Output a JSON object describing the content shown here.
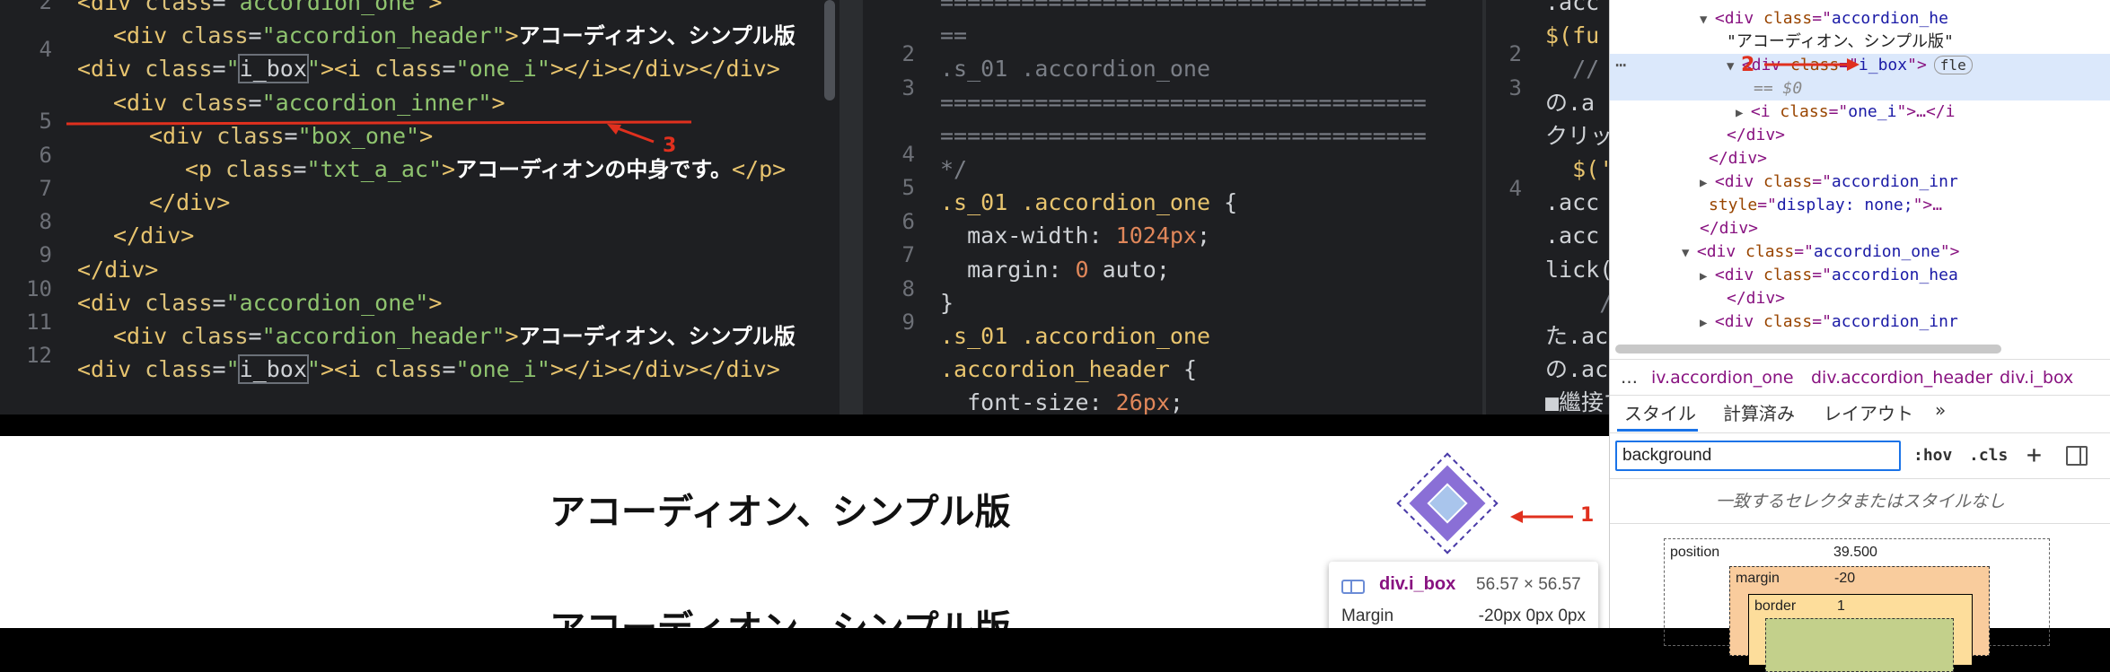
{
  "editor_left": {
    "line_numbers": [
      "2",
      "4",
      "5",
      "6",
      "7",
      "8",
      "9",
      "10",
      "11",
      "12"
    ],
    "lines": [
      {
        "parts": [
          [
            "tg",
            "<div "
          ],
          [
            "at",
            "class"
          ],
          [
            "pl",
            "="
          ],
          [
            "st",
            "\"accordion_one\""
          ],
          [
            "tg",
            ">"
          ]
        ]
      },
      {
        "parts": [
          [
            "tg",
            "<div "
          ],
          [
            "at",
            "class"
          ],
          [
            "pl",
            "="
          ],
          [
            "st",
            "\"accordion_header\""
          ],
          [
            "tg",
            ">"
          ],
          [
            "jp",
            "アコーディオン、シンプル版"
          ]
        ]
      },
      {
        "parts": [
          [
            "tg",
            "<div "
          ],
          [
            "at",
            "class"
          ],
          [
            "pl",
            "="
          ],
          [
            "st",
            "\""
          ],
          [
            "hl",
            "i_box"
          ],
          [
            "st",
            "\""
          ],
          [
            "tg",
            "><i "
          ],
          [
            "at",
            "class"
          ],
          [
            "pl",
            "="
          ],
          [
            "st",
            "\"one_i\""
          ],
          [
            "tg",
            "></i></div></div>"
          ]
        ]
      },
      {
        "parts": [
          [
            "tg",
            "<div "
          ],
          [
            "at",
            "class"
          ],
          [
            "pl",
            "="
          ],
          [
            "st",
            "\"accordion_inner\""
          ],
          [
            "tg",
            ">"
          ]
        ]
      },
      {
        "parts": [
          [
            "tg",
            "<div "
          ],
          [
            "at",
            "class"
          ],
          [
            "pl",
            "="
          ],
          [
            "st",
            "\"box_one\""
          ],
          [
            "tg",
            ">"
          ]
        ]
      },
      {
        "parts": [
          [
            "tg",
            "<p "
          ],
          [
            "at",
            "class"
          ],
          [
            "pl",
            "="
          ],
          [
            "st",
            "\"txt_a_ac\""
          ],
          [
            "tg",
            ">"
          ],
          [
            "jp",
            "アコーディオンの中身です。"
          ],
          [
            "tg",
            "</p>"
          ]
        ]
      },
      {
        "parts": [
          [
            "tg",
            "</div>"
          ]
        ]
      },
      {
        "parts": [
          [
            "tg",
            "</div>"
          ]
        ]
      },
      {
        "parts": [
          [
            "tg",
            "</div>"
          ]
        ]
      },
      {
        "parts": [
          [
            "tg",
            "<div "
          ],
          [
            "at",
            "class"
          ],
          [
            "pl",
            "="
          ],
          [
            "st",
            "\"accordion_one\""
          ],
          [
            "tg",
            ">"
          ]
        ]
      },
      {
        "parts": [
          [
            "tg",
            "<div "
          ],
          [
            "at",
            "class"
          ],
          [
            "pl",
            "="
          ],
          [
            "st",
            "\"accordion_header\""
          ],
          [
            "tg",
            ">"
          ],
          [
            "jp",
            "アコーディオン、シンプル版"
          ]
        ]
      },
      {
        "parts": [
          [
            "tg",
            "<div "
          ],
          [
            "at",
            "class"
          ],
          [
            "pl",
            "="
          ],
          [
            "st",
            "\""
          ],
          [
            "hl",
            "i_box"
          ],
          [
            "st",
            "\""
          ],
          [
            "tg",
            "><i "
          ],
          [
            "at",
            "class"
          ],
          [
            "pl",
            "="
          ],
          [
            "st",
            "\"one_i\""
          ],
          [
            "tg",
            "></i></div></div>"
          ]
        ]
      }
    ]
  },
  "editor_mid": {
    "line_numbers": [
      "2",
      "3",
      "4",
      "5",
      "6",
      "7",
      "8",
      "9"
    ],
    "rule": "====================================",
    "lines": [
      {
        "parts": [
          [
            "cm",
            "===================================="
          ]
        ]
      },
      {
        "parts": [
          [
            "cm",
            "=="
          ]
        ]
      },
      {
        "parts": [
          [
            "cm",
            ".s_01 .accordion_one"
          ]
        ]
      },
      {
        "parts": [
          [
            "cm",
            "===================================="
          ]
        ]
      },
      {
        "parts": [
          [
            "cm",
            "===================================="
          ]
        ]
      },
      {
        "parts": [
          [
            "cm",
            "*/"
          ]
        ]
      },
      {
        "parts": [
          [
            "sel",
            ".s_01 .accordion_one "
          ],
          [
            "pr",
            "{"
          ]
        ]
      },
      {
        "parts": [
          [
            "pr",
            "  max-width: "
          ],
          [
            "nm",
            "1024px"
          ],
          [
            "pr",
            ";"
          ]
        ]
      },
      {
        "parts": [
          [
            "pr",
            "  margin: "
          ],
          [
            "nm",
            "0"
          ],
          [
            "pr",
            " auto;"
          ]
        ]
      },
      {
        "parts": [
          [
            "pr",
            "}"
          ]
        ]
      },
      {
        "parts": [
          [
            "sel",
            ".s_01 .accordion_one"
          ]
        ]
      },
      {
        "parts": [
          [
            "sel",
            ".accordion_header "
          ],
          [
            "pr",
            "{"
          ]
        ]
      },
      {
        "parts": [
          [
            "pr",
            "  font-size: "
          ],
          [
            "nm",
            "26px"
          ],
          [
            "pr",
            ";"
          ]
        ]
      }
    ]
  },
  "editor_right": {
    "line_numbers": [
      "2",
      "3",
      "4"
    ],
    "lines": [
      {
        "parts": [
          [
            "pr",
            ".acc"
          ]
        ]
      },
      {
        "parts": [
          [
            "sel",
            "$(fu"
          ]
        ]
      },
      {
        "parts": [
          [
            "cm",
            "  //"
          ]
        ]
      },
      {
        "parts": [
          [
            "pr",
            "の.a"
          ]
        ]
      },
      {
        "parts": [
          [
            "pr",
            "クリック"
          ]
        ]
      },
      {
        "parts": [
          [
            "sel",
            "  $('"
          ]
        ]
      },
      {
        "parts": [
          [
            "pr",
            ".acc"
          ]
        ]
      },
      {
        "parts": [
          [
            "pr",
            ".acc"
          ]
        ]
      },
      {
        "parts": [
          [
            "pr",
            "lick("
          ]
        ]
      },
      {
        "parts": [
          [
            "cm",
            "    /"
          ]
        ]
      },
      {
        "parts": [
          [
            "pr",
            "た.ac"
          ]
        ]
      },
      {
        "parts": [
          [
            "pr",
            "の.ac"
          ]
        ]
      },
      {
        "parts": [
          [
            "pr",
            "■繼接す"
          ]
        ]
      }
    ]
  },
  "browser": {
    "headers": [
      "アコーディオン、シンプル版",
      "アコーディオン、シンプル版"
    ]
  },
  "tooltip": {
    "name": "div.i_box",
    "size": "56.57 × 56.57",
    "margin_label": "Margin",
    "margin_value": "-20px 0px 0px"
  },
  "annotations": {
    "one": "1",
    "two": "2",
    "three": "3"
  },
  "devtools": {
    "elements": [
      {
        "indent": 270,
        "tri": "▼",
        "parts": [
          [
            "tgd",
            "<div "
          ],
          [
            "atd",
            "class"
          ],
          [
            "tgd",
            "=\""
          ],
          [
            "avd",
            "accordion_he"
          ]
        ]
      },
      {
        "indent": 300,
        "tri": "",
        "parts": [
          [
            "txd",
            "\"アコーディオン、シンプル版\""
          ]
        ]
      },
      {
        "indent": 300,
        "tri": "▼",
        "parts": [
          [
            "tgd",
            "<div "
          ],
          [
            "atd",
            "class"
          ],
          [
            "tgd",
            "=\""
          ],
          [
            "avd",
            "i_box"
          ],
          [
            "tgd",
            "\">"
          ]
        ],
        "selected": true,
        "badge": "fle"
      },
      {
        "indent": 330,
        "tri": "",
        "parts": [
          [
            "cm",
            "== $0"
          ]
        ]
      },
      {
        "indent": 310,
        "tri": "▶",
        "parts": [
          [
            "tgd",
            "<i "
          ],
          [
            "atd",
            "class"
          ],
          [
            "tgd",
            "=\""
          ],
          [
            "avd",
            "one_i"
          ],
          [
            "tgd",
            "\">…</i"
          ]
        ]
      },
      {
        "indent": 300,
        "tri": "",
        "parts": [
          [
            "tgd",
            "</div>"
          ]
        ]
      },
      {
        "indent": 280,
        "tri": "",
        "parts": [
          [
            "tgd",
            "</div>"
          ]
        ]
      },
      {
        "indent": 270,
        "tri": "▶",
        "parts": [
          [
            "tgd",
            "<div "
          ],
          [
            "atd",
            "class"
          ],
          [
            "tgd",
            "=\""
          ],
          [
            "avd",
            "accordion_inr"
          ]
        ]
      },
      {
        "indent": 280,
        "tri": "",
        "parts": [
          [
            "atd",
            "style"
          ],
          [
            "tgd",
            "=\""
          ],
          [
            "avd",
            "display: none;"
          ],
          [
            "tgd",
            "\">…"
          ]
        ]
      },
      {
        "indent": 270,
        "tri": "",
        "parts": [
          [
            "tgd",
            "</div>"
          ]
        ]
      },
      {
        "indent": 250,
        "tri": "▼",
        "parts": [
          [
            "tgd",
            "<div "
          ],
          [
            "atd",
            "class"
          ],
          [
            "tgd",
            "=\""
          ],
          [
            "avd",
            "accordion_one"
          ],
          [
            "tgd",
            "\">"
          ]
        ]
      },
      {
        "indent": 270,
        "tri": "▶",
        "parts": [
          [
            "tgd",
            "<div "
          ],
          [
            "atd",
            "class"
          ],
          [
            "tgd",
            "=\""
          ],
          [
            "avd",
            "accordion_hea"
          ]
        ]
      },
      {
        "indent": 300,
        "tri": "",
        "parts": [
          [
            "tgd",
            "</div>"
          ]
        ]
      },
      {
        "indent": 270,
        "tri": "▶",
        "parts": [
          [
            "tgd",
            "<div "
          ],
          [
            "atd",
            "class"
          ],
          [
            "tgd",
            "=\""
          ],
          [
            "avd",
            "accordion_inr"
          ]
        ]
      }
    ],
    "breadcrumb": [
      "…",
      "iv.accordion_one",
      "div.accordion_header",
      "div.i_box"
    ],
    "tabs": [
      "スタイル",
      "計算済み",
      "レイアウト",
      "»"
    ],
    "filter_value": "background",
    "hov": ":hov",
    "cls": ".cls",
    "plus": "+",
    "no_match": "一致するセレクタまたはスタイルなし",
    "box_model": {
      "position_label": "position",
      "position_value": "39.500",
      "margin_label": "margin",
      "margin_value": "-20",
      "border_label": "border",
      "border_value": "1"
    }
  },
  "colors": {
    "editor_bg": "#1e1f22",
    "highlight_row": "#dbe8fb",
    "annotation_red": "#e0301e",
    "diamond_fill": "#a9c5ec",
    "diamond_border": "#8a6fd6",
    "margin_box": "#f9cc9d"
  }
}
